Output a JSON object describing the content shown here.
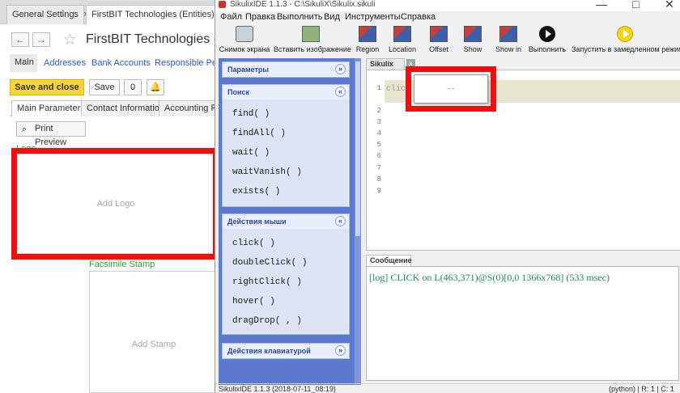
{
  "onec": {
    "tabs": [
      {
        "label": "General Settings",
        "close": "×"
      },
      {
        "label": "FirstBIT Technologies (Entities) *",
        "close": "×"
      }
    ],
    "nav": {
      "back": "←",
      "forward": "→"
    },
    "page_title": "FirstBIT Technologies (Entities)",
    "subnav": [
      "Main",
      "Addresses",
      "Bank Accounts",
      "Responsible Persons"
    ],
    "buttons": {
      "save_close": "Save and close",
      "save": "Save",
      "attach": "0",
      "bell": "🔔"
    },
    "form_tabs": [
      "Main Parameters",
      "Contact Information",
      "Accounting Parameters"
    ],
    "print_preview": "Print Preview",
    "logo_label": "Logo",
    "logo_placeholder": "Add Logo",
    "stamp_label": "Facsimile Stamp",
    "stamp_placeholder": "Add Stamp",
    "highlight_color": "#ee1010"
  },
  "ide": {
    "title": "SikulixIDE 1.1.3 - C:\\SikuliX\\Sikulix.sikuli",
    "window_controls": {
      "minimize": "—",
      "maximize": "□",
      "close": "✕"
    },
    "menu": [
      "Файл",
      "Правка",
      "Выполнить",
      "Вид",
      "Инструменты",
      "Справка"
    ],
    "toolbar": [
      {
        "label": "Снимок экрана",
        "icon": "camera-icon"
      },
      {
        "label": "Вставить изображение",
        "icon": "insert-image-icon"
      },
      {
        "label": "Region",
        "icon": "region-icon"
      },
      {
        "label": "Location",
        "icon": "location-icon"
      },
      {
        "label": "Offset",
        "icon": "offset-icon"
      },
      {
        "label": "Show",
        "icon": "show-icon"
      },
      {
        "label": "Show in",
        "icon": "show-in-icon"
      },
      {
        "label": "Выполнить",
        "icon": "run-icon"
      },
      {
        "label": "Запустить в замедленном режиме",
        "icon": "slow-run-icon"
      }
    ],
    "sidebar": {
      "panels": [
        {
          "title": "Параметры",
          "chevron": "»",
          "items": []
        },
        {
          "title": "Поиск",
          "chevron": "«",
          "items": [
            "find( )",
            "findAll( )",
            "wait( )",
            "waitVanish( )",
            "exists( )"
          ]
        },
        {
          "title": "Действия мыши",
          "chevron": "«",
          "items": [
            "click( )",
            "doubleClick( )",
            "rightClick( )",
            "hover( )",
            "dragDrop( , )"
          ]
        },
        {
          "title": "Действия клавиатурой",
          "chevron": "»",
          "items": []
        }
      ]
    },
    "editor": {
      "tab": "Sikulix",
      "tab_close": "x",
      "line_numbers": [
        "1",
        "2",
        "3",
        "4",
        "5",
        "6",
        "7",
        "8",
        "9"
      ],
      "code": "click",
      "screenshot_placeholder": "- -"
    },
    "message": {
      "tab": "Сообщение",
      "text": "[log] CLICK on L(463,371)@S(0)[0,0 1366x768] (533 msec)"
    },
    "status": {
      "left": "SikulixIDE 1.1.3 (2018-07-11_08:19)",
      "right": "(python) | R: 1 | C: 1"
    }
  }
}
